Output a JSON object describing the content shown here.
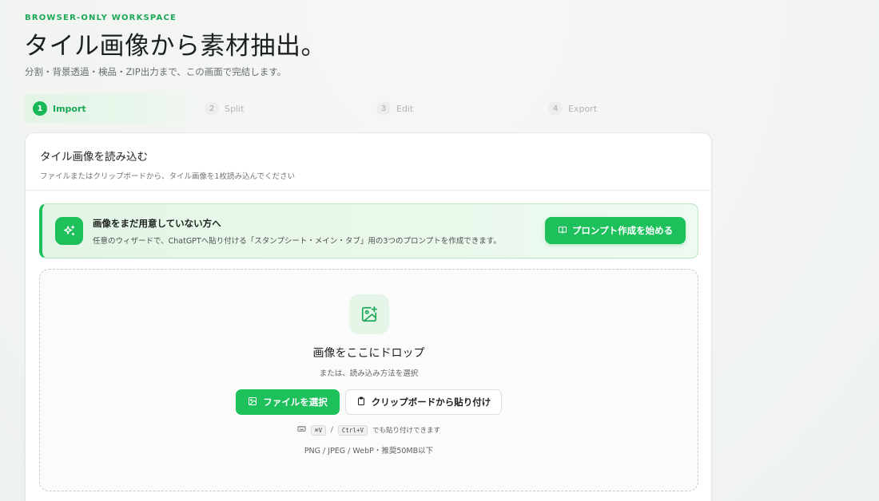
{
  "header": {
    "eyebrow": "BROWSER-ONLY WORKSPACE",
    "title": "タイル画像から素材抽出。",
    "subtitle": "分割・背景透過・検品・ZIP出力まで、この画面で完結します。"
  },
  "steps": [
    {
      "num": "1",
      "label": "Import",
      "active": true
    },
    {
      "num": "2",
      "label": "Split",
      "active": false
    },
    {
      "num": "3",
      "label": "Edit",
      "active": false
    },
    {
      "num": "4",
      "label": "Export",
      "active": false
    }
  ],
  "card": {
    "title": "タイル画像を読み込む",
    "desc": "ファイルまたはクリップボードから、タイル画像を1枚読み込んでください"
  },
  "banner": {
    "icon": "sparkles-icon",
    "title": "画像をまだ用意していない方へ",
    "desc": "任意のウィザードで、ChatGPTへ貼り付ける「スタンプシート・メイン・タブ」用の3つのプロンプトを作成できます。",
    "button_label": "プロンプト作成を始める"
  },
  "dropzone": {
    "icon": "image-plus-icon",
    "title": "画像をここにドロップ",
    "subtitle": "または、読み込み方法を選択",
    "select_file_label": "ファイルを選択",
    "paste_label": "クリップボードから貼り付け",
    "shortcut_mac": "⌘V",
    "shortcut_sep": "/",
    "shortcut_win": "Ctrl+V",
    "shortcut_text": "でも貼り付けできます",
    "formats": "PNG / JPEG / WebP・推奨50MB以下"
  },
  "colors": {
    "accent": "#1ec05c",
    "accent_text": "#1aa756"
  }
}
